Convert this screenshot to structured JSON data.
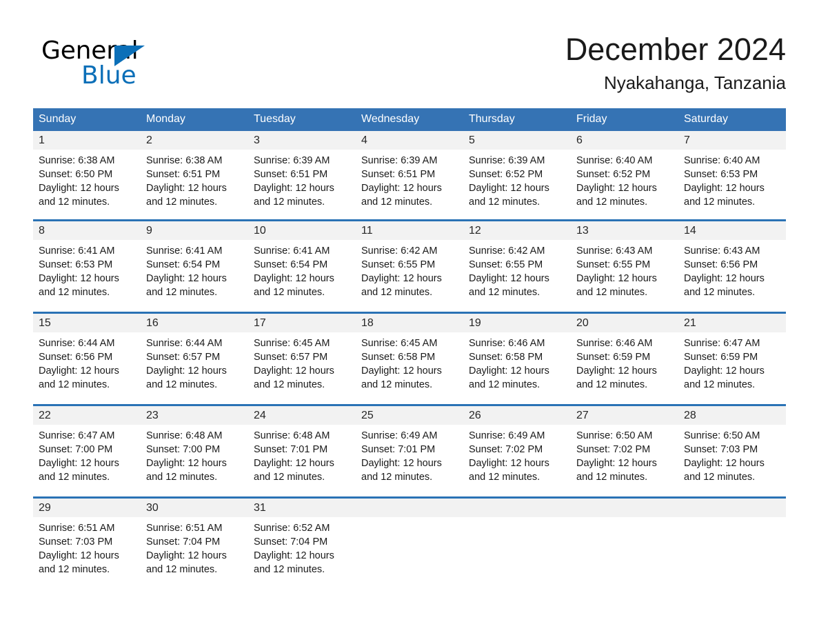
{
  "brand": {
    "name_part1": "General",
    "name_part2": "Blue",
    "triangle_color": "#0b6fb8"
  },
  "header": {
    "month_title": "December 2024",
    "location": "Nyakahanga, Tanzania"
  },
  "theme": {
    "header_bar_color": "#3573b4",
    "row_divider_color": "#2a72b5",
    "daynum_band_color": "#f2f2f2",
    "text_color": "#1a1a1a"
  },
  "weekday_headers": [
    "Sunday",
    "Monday",
    "Tuesday",
    "Wednesday",
    "Thursday",
    "Friday",
    "Saturday"
  ],
  "weeks": [
    [
      {
        "day": "1",
        "sunrise": "Sunrise: 6:38 AM",
        "sunset": "Sunset: 6:50 PM",
        "daylight_line1": "Daylight: 12 hours",
        "daylight_line2": "and 12 minutes."
      },
      {
        "day": "2",
        "sunrise": "Sunrise: 6:38 AM",
        "sunset": "Sunset: 6:51 PM",
        "daylight_line1": "Daylight: 12 hours",
        "daylight_line2": "and 12 minutes."
      },
      {
        "day": "3",
        "sunrise": "Sunrise: 6:39 AM",
        "sunset": "Sunset: 6:51 PM",
        "daylight_line1": "Daylight: 12 hours",
        "daylight_line2": "and 12 minutes."
      },
      {
        "day": "4",
        "sunrise": "Sunrise: 6:39 AM",
        "sunset": "Sunset: 6:51 PM",
        "daylight_line1": "Daylight: 12 hours",
        "daylight_line2": "and 12 minutes."
      },
      {
        "day": "5",
        "sunrise": "Sunrise: 6:39 AM",
        "sunset": "Sunset: 6:52 PM",
        "daylight_line1": "Daylight: 12 hours",
        "daylight_line2": "and 12 minutes."
      },
      {
        "day": "6",
        "sunrise": "Sunrise: 6:40 AM",
        "sunset": "Sunset: 6:52 PM",
        "daylight_line1": "Daylight: 12 hours",
        "daylight_line2": "and 12 minutes."
      },
      {
        "day": "7",
        "sunrise": "Sunrise: 6:40 AM",
        "sunset": "Sunset: 6:53 PM",
        "daylight_line1": "Daylight: 12 hours",
        "daylight_line2": "and 12 minutes."
      }
    ],
    [
      {
        "day": "8",
        "sunrise": "Sunrise: 6:41 AM",
        "sunset": "Sunset: 6:53 PM",
        "daylight_line1": "Daylight: 12 hours",
        "daylight_line2": "and 12 minutes."
      },
      {
        "day": "9",
        "sunrise": "Sunrise: 6:41 AM",
        "sunset": "Sunset: 6:54 PM",
        "daylight_line1": "Daylight: 12 hours",
        "daylight_line2": "and 12 minutes."
      },
      {
        "day": "10",
        "sunrise": "Sunrise: 6:41 AM",
        "sunset": "Sunset: 6:54 PM",
        "daylight_line1": "Daylight: 12 hours",
        "daylight_line2": "and 12 minutes."
      },
      {
        "day": "11",
        "sunrise": "Sunrise: 6:42 AM",
        "sunset": "Sunset: 6:55 PM",
        "daylight_line1": "Daylight: 12 hours",
        "daylight_line2": "and 12 minutes."
      },
      {
        "day": "12",
        "sunrise": "Sunrise: 6:42 AM",
        "sunset": "Sunset: 6:55 PM",
        "daylight_line1": "Daylight: 12 hours",
        "daylight_line2": "and 12 minutes."
      },
      {
        "day": "13",
        "sunrise": "Sunrise: 6:43 AM",
        "sunset": "Sunset: 6:55 PM",
        "daylight_line1": "Daylight: 12 hours",
        "daylight_line2": "and 12 minutes."
      },
      {
        "day": "14",
        "sunrise": "Sunrise: 6:43 AM",
        "sunset": "Sunset: 6:56 PM",
        "daylight_line1": "Daylight: 12 hours",
        "daylight_line2": "and 12 minutes."
      }
    ],
    [
      {
        "day": "15",
        "sunrise": "Sunrise: 6:44 AM",
        "sunset": "Sunset: 6:56 PM",
        "daylight_line1": "Daylight: 12 hours",
        "daylight_line2": "and 12 minutes."
      },
      {
        "day": "16",
        "sunrise": "Sunrise: 6:44 AM",
        "sunset": "Sunset: 6:57 PM",
        "daylight_line1": "Daylight: 12 hours",
        "daylight_line2": "and 12 minutes."
      },
      {
        "day": "17",
        "sunrise": "Sunrise: 6:45 AM",
        "sunset": "Sunset: 6:57 PM",
        "daylight_line1": "Daylight: 12 hours",
        "daylight_line2": "and 12 minutes."
      },
      {
        "day": "18",
        "sunrise": "Sunrise: 6:45 AM",
        "sunset": "Sunset: 6:58 PM",
        "daylight_line1": "Daylight: 12 hours",
        "daylight_line2": "and 12 minutes."
      },
      {
        "day": "19",
        "sunrise": "Sunrise: 6:46 AM",
        "sunset": "Sunset: 6:58 PM",
        "daylight_line1": "Daylight: 12 hours",
        "daylight_line2": "and 12 minutes."
      },
      {
        "day": "20",
        "sunrise": "Sunrise: 6:46 AM",
        "sunset": "Sunset: 6:59 PM",
        "daylight_line1": "Daylight: 12 hours",
        "daylight_line2": "and 12 minutes."
      },
      {
        "day": "21",
        "sunrise": "Sunrise: 6:47 AM",
        "sunset": "Sunset: 6:59 PM",
        "daylight_line1": "Daylight: 12 hours",
        "daylight_line2": "and 12 minutes."
      }
    ],
    [
      {
        "day": "22",
        "sunrise": "Sunrise: 6:47 AM",
        "sunset": "Sunset: 7:00 PM",
        "daylight_line1": "Daylight: 12 hours",
        "daylight_line2": "and 12 minutes."
      },
      {
        "day": "23",
        "sunrise": "Sunrise: 6:48 AM",
        "sunset": "Sunset: 7:00 PM",
        "daylight_line1": "Daylight: 12 hours",
        "daylight_line2": "and 12 minutes."
      },
      {
        "day": "24",
        "sunrise": "Sunrise: 6:48 AM",
        "sunset": "Sunset: 7:01 PM",
        "daylight_line1": "Daylight: 12 hours",
        "daylight_line2": "and 12 minutes."
      },
      {
        "day": "25",
        "sunrise": "Sunrise: 6:49 AM",
        "sunset": "Sunset: 7:01 PM",
        "daylight_line1": "Daylight: 12 hours",
        "daylight_line2": "and 12 minutes."
      },
      {
        "day": "26",
        "sunrise": "Sunrise: 6:49 AM",
        "sunset": "Sunset: 7:02 PM",
        "daylight_line1": "Daylight: 12 hours",
        "daylight_line2": "and 12 minutes."
      },
      {
        "day": "27",
        "sunrise": "Sunrise: 6:50 AM",
        "sunset": "Sunset: 7:02 PM",
        "daylight_line1": "Daylight: 12 hours",
        "daylight_line2": "and 12 minutes."
      },
      {
        "day": "28",
        "sunrise": "Sunrise: 6:50 AM",
        "sunset": "Sunset: 7:03 PM",
        "daylight_line1": "Daylight: 12 hours",
        "daylight_line2": "and 12 minutes."
      }
    ],
    [
      {
        "day": "29",
        "sunrise": "Sunrise: 6:51 AM",
        "sunset": "Sunset: 7:03 PM",
        "daylight_line1": "Daylight: 12 hours",
        "daylight_line2": "and 12 minutes."
      },
      {
        "day": "30",
        "sunrise": "Sunrise: 6:51 AM",
        "sunset": "Sunset: 7:04 PM",
        "daylight_line1": "Daylight: 12 hours",
        "daylight_line2": "and 12 minutes."
      },
      {
        "day": "31",
        "sunrise": "Sunrise: 6:52 AM",
        "sunset": "Sunset: 7:04 PM",
        "daylight_line1": "Daylight: 12 hours",
        "daylight_line2": "and 12 minutes."
      },
      {
        "day": "",
        "sunrise": "",
        "sunset": "",
        "daylight_line1": "",
        "daylight_line2": ""
      },
      {
        "day": "",
        "sunrise": "",
        "sunset": "",
        "daylight_line1": "",
        "daylight_line2": ""
      },
      {
        "day": "",
        "sunrise": "",
        "sunset": "",
        "daylight_line1": "",
        "daylight_line2": ""
      },
      {
        "day": "",
        "sunrise": "",
        "sunset": "",
        "daylight_line1": "",
        "daylight_line2": ""
      }
    ]
  ]
}
